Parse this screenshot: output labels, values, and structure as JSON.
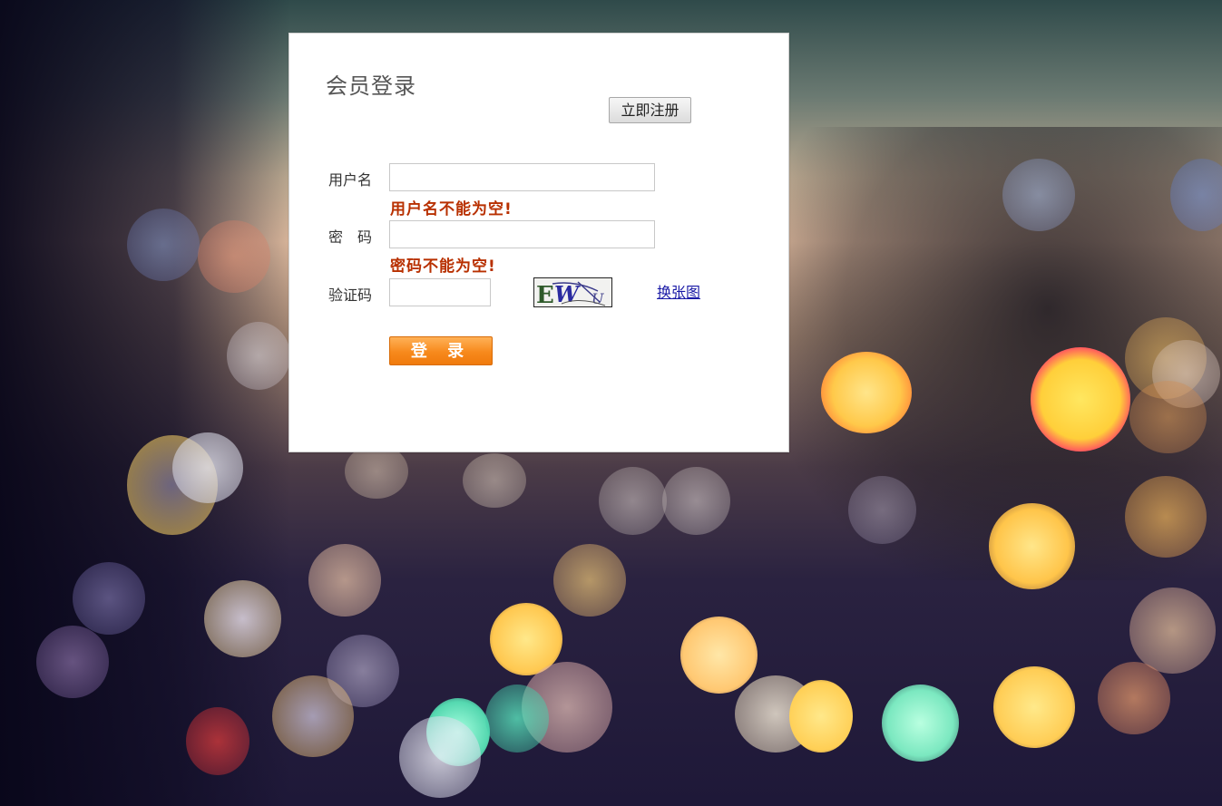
{
  "login": {
    "title": "会员登录",
    "register_label": "立即注册",
    "username_label": "用户名",
    "username_value": "",
    "username_error": "用户名不能为空!",
    "password_label": "密　码",
    "password_value": "",
    "password_error": "密码不能为空!",
    "captcha_label": "验证码",
    "captcha_value": "",
    "captcha_text": "EWU",
    "refresh_label": "换张图",
    "submit_label": "登 录"
  },
  "colors": {
    "error": "#b83000",
    "submit_button": "#f7891c",
    "link": "#1a1aa6"
  },
  "icons": {
    "captcha_image": "captcha-image"
  }
}
